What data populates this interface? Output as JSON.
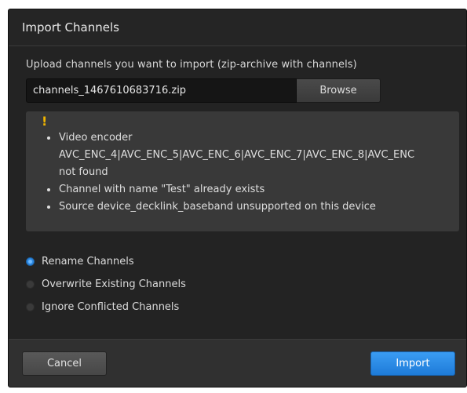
{
  "dialog": {
    "title": "Import Channels",
    "upload_label": "Upload channels you want to import (zip-archive with channels)",
    "file_value": "channels_1467610683716.zip",
    "browse_label": "Browse",
    "warning": {
      "icon": "!",
      "items": [
        "Video encoder",
        "AVC_ENC_4|AVC_ENC_5|AVC_ENC_6|AVC_ENC_7|AVC_ENC_8|AVC_ENC",
        "not found",
        "Channel with name \"Test\" already exists",
        "Source device_decklink_baseband unsupported on this device"
      ]
    },
    "options": [
      {
        "label": "Rename Channels",
        "selected": true
      },
      {
        "label": "Overwrite Existing Channels",
        "selected": false
      },
      {
        "label": "Ignore Conflicted Channels",
        "selected": false
      }
    ],
    "cancel_label": "Cancel",
    "import_label": "Import"
  },
  "colors": {
    "accent": "#2a86e0",
    "warning": "#f0b400",
    "background": "#232323"
  }
}
